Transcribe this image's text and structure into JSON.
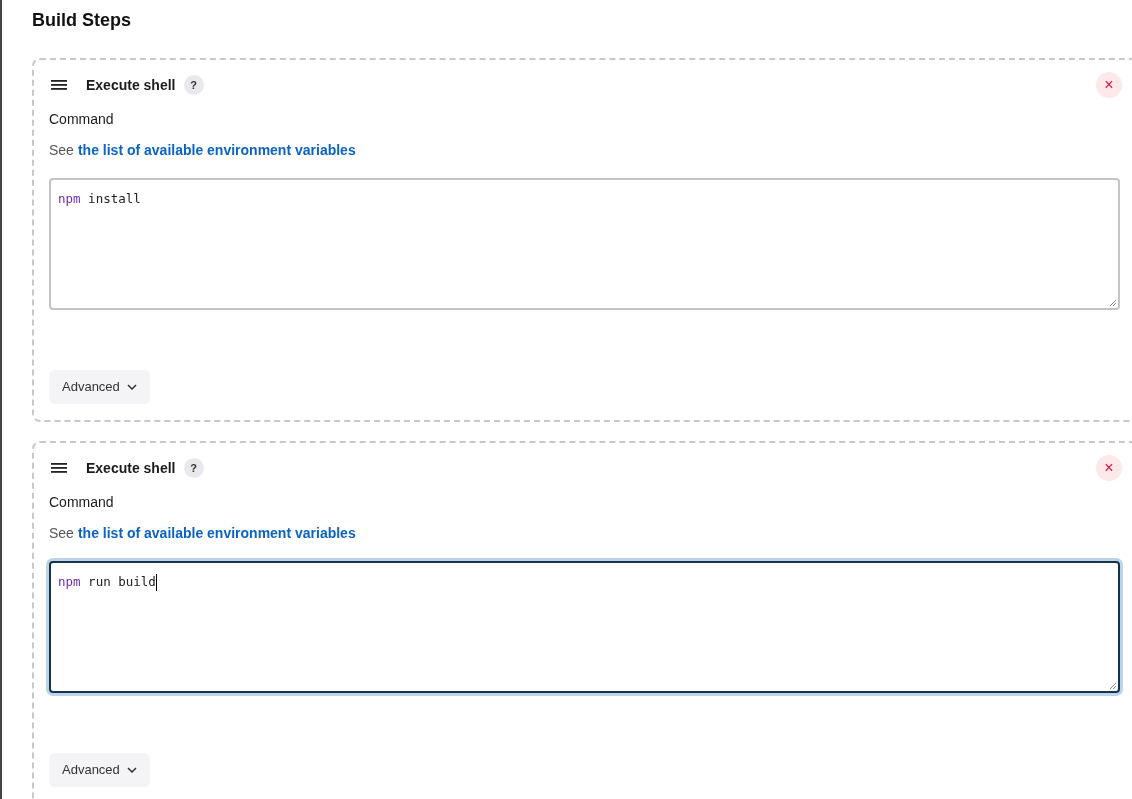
{
  "section_title": "Build Steps",
  "steps": [
    {
      "title": "Execute shell",
      "help": "?",
      "remove": "×",
      "field_label": "Command",
      "hint": "See",
      "hint_link": "the list of available environment variables",
      "command": {
        "program": "npm",
        "args": "install"
      },
      "focused": false,
      "advanced": "Advanced"
    },
    {
      "title": "Execute shell",
      "help": "?",
      "remove": "×",
      "field_label": "Command",
      "hint": "See",
      "hint_link": "the list of available environment variables",
      "command": {
        "program": "npm",
        "args": "run build"
      },
      "focused": true,
      "advanced": "Advanced"
    }
  ]
}
